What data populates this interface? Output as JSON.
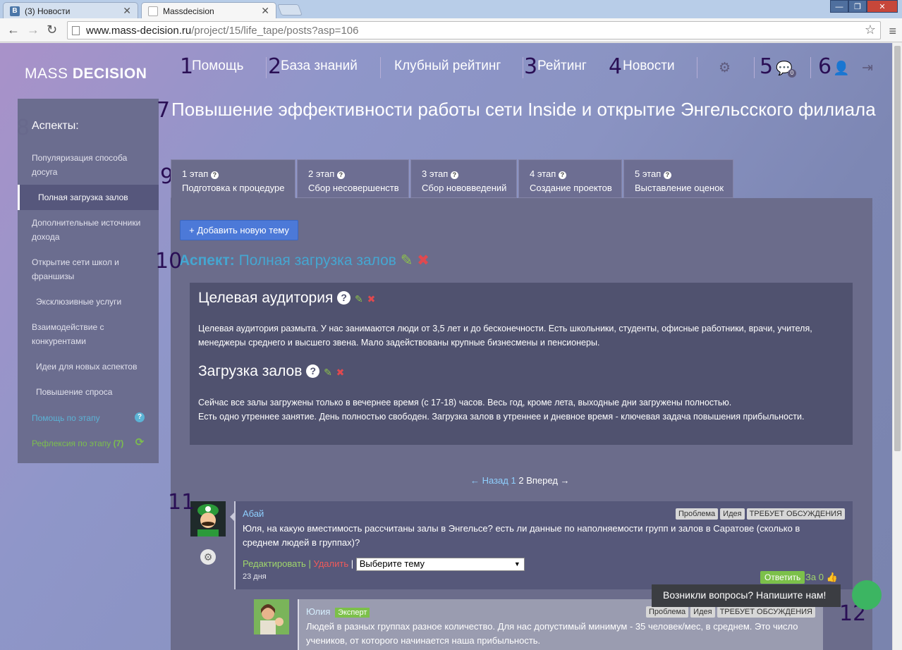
{
  "browser": {
    "tabs": [
      {
        "label": "(3) Новости",
        "favicon": "vk-icon"
      },
      {
        "label": "Massdecision",
        "favicon": "page-icon"
      }
    ],
    "url_domain": "www.mass-decision.ru",
    "url_path": "/project/15/life_tape/posts?asp=106"
  },
  "header": {
    "logo_light": "MASS",
    "logo_bold": "DECISION",
    "nav": [
      "Помощь",
      "База знаний",
      "Клубный рейтинг",
      "Рейтинг",
      "Новости"
    ],
    "messages_count": "0",
    "icons": [
      "gear-icon",
      "chat-icon",
      "user-icon",
      "logout-icon"
    ]
  },
  "annotations": [
    "1",
    "2",
    "3",
    "4",
    "5",
    "6",
    "7",
    "8",
    "9",
    "10",
    "11",
    "12"
  ],
  "sidebar": {
    "title": "Аспекты:",
    "items": [
      "Популяризация способа досуга",
      "Полная загрузка залов",
      "Дополнительные источники дохода",
      "Открытие сети школ и франшизы",
      "Эксклюзивные услуги",
      "Взаимодействие с конкурентами",
      "Идеи для новых аспектов",
      "Повышение спроса"
    ],
    "active_index": 1,
    "help_label": "Помощь по этапу",
    "reflection_label": "Рефлексия по этапу",
    "reflection_count": "(7)"
  },
  "main": {
    "title": "Повышение эффективности работы сети Inside и открытие Энгельсского филиала",
    "stages": [
      {
        "num": "1 этап",
        "label": "Подготовка к процедуре"
      },
      {
        "num": "2 этап",
        "label": "Сбор несовершенств"
      },
      {
        "num": "3 этап",
        "label": "Сбор нововведений"
      },
      {
        "num": "4 этап",
        "label": "Создание проектов"
      },
      {
        "num": "5 этап",
        "label": "Выставление оценок"
      }
    ],
    "add_topic_label": "+ Добавить новую тему",
    "aspect_prefix": "Аспект:",
    "aspect_name": "Полная загрузка залов",
    "sections": [
      {
        "heading": "Целевая аудитория",
        "text": "Целевая аудитория размыта. У нас занимаются люди от 3,5 лет и до бесконечности. Есть школьники, студенты, офисные работники, врачи, учителя, менеджеры среднего и высшего звена. Мало задействованы крупные бизнесмены и пенсионеры."
      },
      {
        "heading": "Загрузка залов",
        "text1": "Сейчас все залы загружены только в вечернее время (с 17-18) часов. Весь год, кроме лета, выходные дни загружены полностью.",
        "text2": "Есть одно утреннее занятие. День полностью свободен. Загрузка залов в утреннее и дневное время - ключевая задача повышения прибыльности."
      }
    ],
    "pager": {
      "prev": "← Назад",
      "page1": "1",
      "page2": "2",
      "next": "Вперед →"
    }
  },
  "posts": [
    {
      "author": "Абай",
      "tags": [
        "Проблема",
        "Идея",
        "ТРЕБУЕТ ОБСУЖДЕНИЯ"
      ],
      "text": "Юля, на какую вместимость рассчитаны залы в Энгельсе? есть ли данные по наполняемости групп и залов в Саратове (сколько в среднем людей в группах)?",
      "edit_label": "Редактировать",
      "delete_label": "Удалить",
      "separator": "|",
      "select_value": "Выберите тему",
      "date": "23 дня",
      "reply_label": "Ответить",
      "vote_label": "За 0"
    },
    {
      "author": "Юлия",
      "badge": "Эксперт",
      "tags": [
        "Проблема",
        "Идея",
        "ТРЕБУЕТ ОБСУЖДЕНИЯ"
      ],
      "text": "Людей в разных группах разное количество. Для нас допустимый минимум - 35 человек/мес, в среднем. Это число учеников, от которого начинается наша прибыльность."
    }
  ],
  "chat": {
    "label": "Возникли вопросы? Напишите нам!"
  }
}
